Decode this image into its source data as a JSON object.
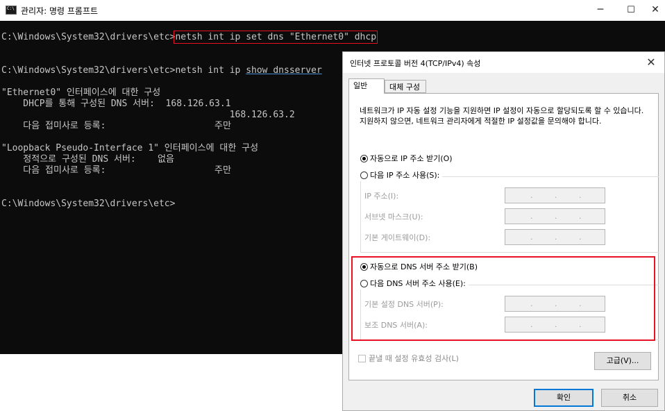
{
  "console_window": {
    "title": "관리자: 명령 프롬프트",
    "icon_text": "C:\\",
    "controls": {
      "minimize": "─",
      "maximize": "☐",
      "close": "✕"
    },
    "lines": {
      "cmd1_prompt": "C:\\Windows\\System32\\drivers\\etc>",
      "cmd1_command": "netsh int ip set dns \"Ethernet0\" dhcp",
      "cmd2_prompt": "C:\\Windows\\System32\\drivers\\etc>netsh int ip ",
      "cmd2_command": "show dnsserver",
      "eth_header": "\"Ethernet0\" 인터페이스에 대한 구성",
      "eth_dhcp_dns": "    DHCP를 통해 구성된 DNS 서버:  168.126.63.1",
      "eth_dns2": "                                          168.126.63.2",
      "eth_suffix": "    다음 접미사로 등록:                    주만",
      "lb_header": "\"Loopback Pseudo-Interface 1\" 인터페이스에 대한 구성",
      "lb_static_dns": "    정적으로 구성된 DNS 서버:    없음",
      "lb_suffix": "    다음 접미사로 등록:                    주만",
      "final_prompt": "C:\\Windows\\System32\\drivers\\etc>"
    }
  },
  "dialog": {
    "title": "인터넷 프로토콜 버전 4(TCP/IPv4) 속성",
    "close": "✕",
    "tabs": {
      "general": "일반",
      "alternate": "대체 구성"
    },
    "description": "네트워크가 IP 자동 설정 기능을 지원하면 IP 설정이 자동으로 할당되도록 할 수 있습니다. 지원하지 않으면, 네트워크 관리자에게 적절한 IP 설정값을 문의해야 합니다.",
    "ip": {
      "auto_label": "자동으로 IP 주소 받기(O)",
      "manual_label": "다음 IP 주소 사용(S):",
      "address_label": "IP 주소(I):",
      "subnet_label": "서브넷 마스크(U):",
      "gateway_label": "기본 게이트웨이(D):"
    },
    "dns": {
      "auto_label": "자동으로 DNS 서버 주소 받기(B)",
      "manual_label": "다음 DNS 서버 주소 사용(E):",
      "preferred_label": "기본 설정 DNS 서버(P):",
      "alternate_label": "보조 DNS 서버(A):"
    },
    "ip_dot": ".",
    "validate_label": "끝낼 때 설정 유효성 검사(L)",
    "advanced_button": "고급(V)...",
    "ok_button": "확인",
    "cancel_button": "취소",
    "selected_ip_mode": "auto",
    "selected_dns_mode": "auto",
    "validate_checked": false
  },
  "colors": {
    "console_bg": "#0c0c0c",
    "console_text": "#c7c7c7",
    "highlight_red": "#e81123",
    "accent_blue": "#0078d7"
  }
}
